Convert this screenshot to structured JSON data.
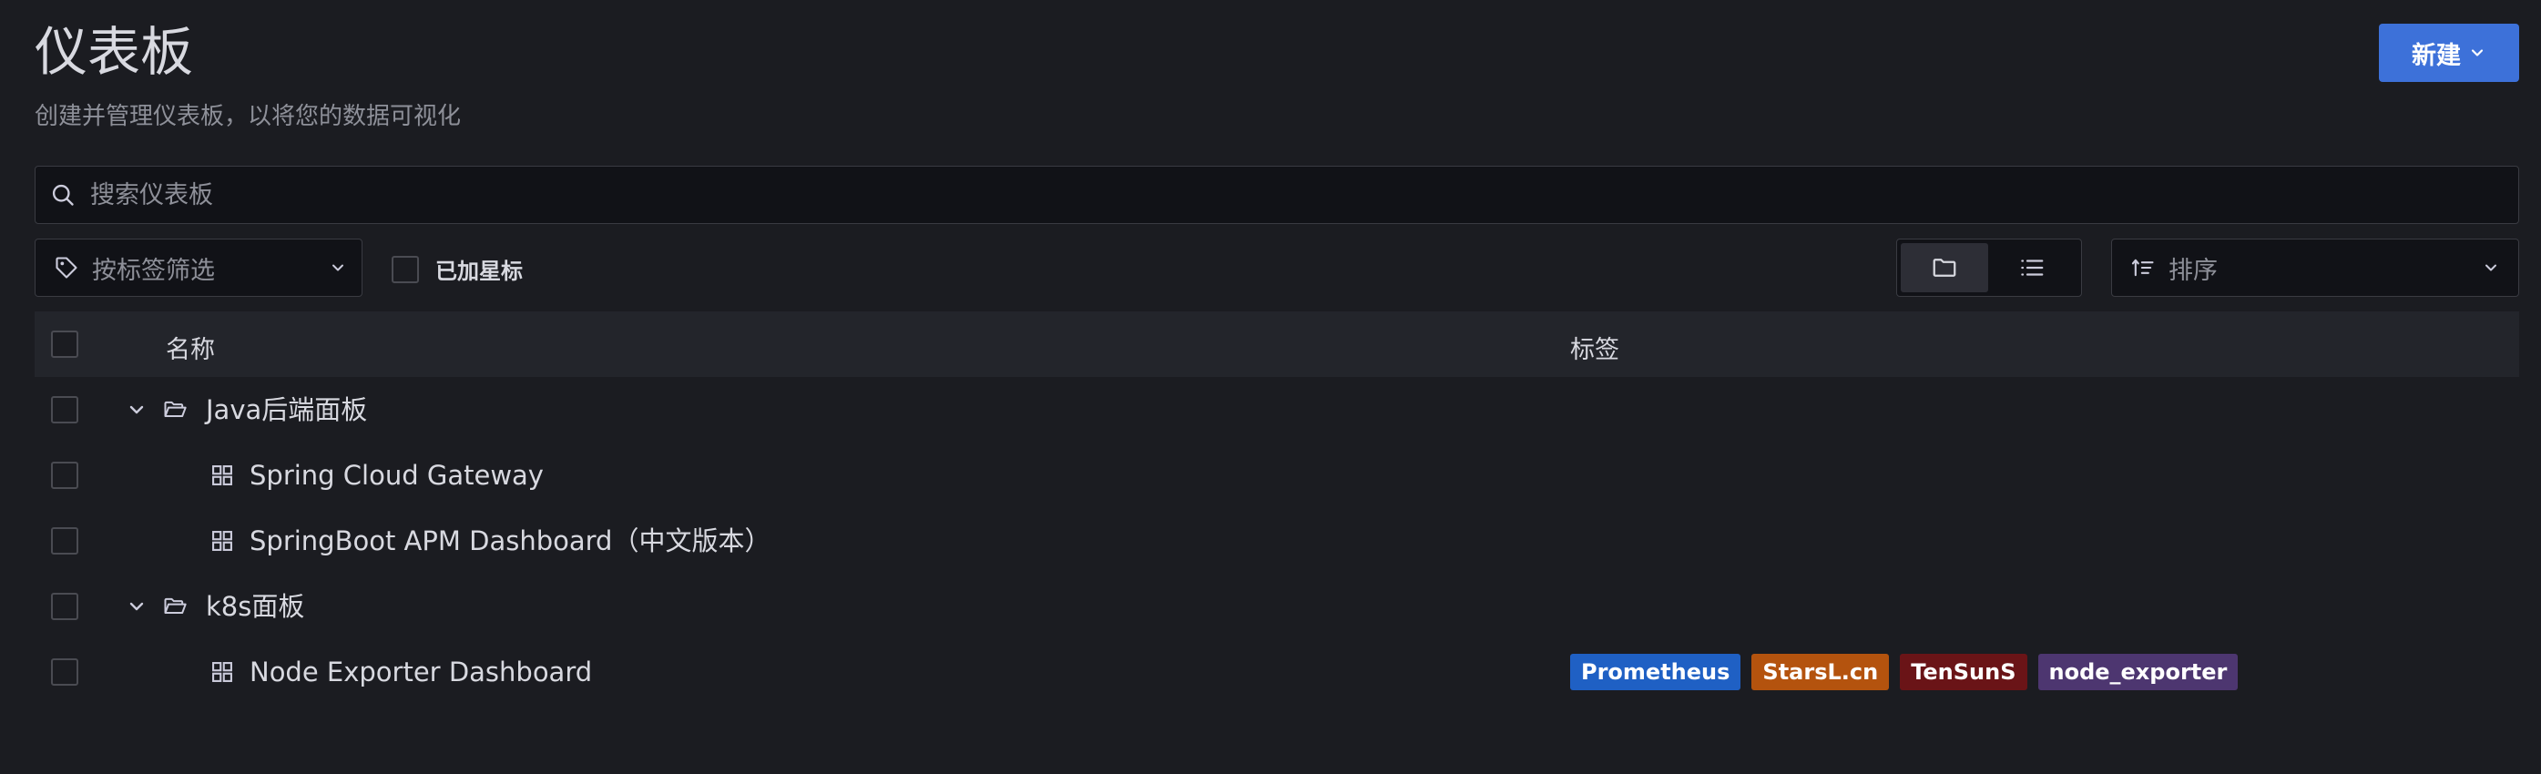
{
  "header": {
    "title": "仪表板",
    "subtitle": "创建并管理仪表板，以将您的数据可视化",
    "new_button_label": "新建"
  },
  "search": {
    "placeholder": "搜索仪表板"
  },
  "filters": {
    "tag_filter_placeholder": "按标签筛选",
    "starred_label": "已加星标",
    "view_mode": "folders",
    "sort_placeholder": "排序"
  },
  "table": {
    "columns": {
      "name": "名称",
      "tags": "标签"
    },
    "rows": [
      {
        "type": "folder",
        "name": "Java后端面板",
        "expanded": true
      },
      {
        "type": "dashboard",
        "name": "Spring Cloud Gateway",
        "tags": []
      },
      {
        "type": "dashboard",
        "name": "SpringBoot APM Dashboard（中文版本）",
        "tags": []
      },
      {
        "type": "folder",
        "name": "k8s面板",
        "expanded": true
      },
      {
        "type": "dashboard",
        "name": "Node Exporter Dashboard",
        "tags": [
          {
            "label": "Prometheus",
            "color": "#1f60c4"
          },
          {
            "label": "StarsL.cn",
            "color": "#b4530e"
          },
          {
            "label": "TenSunS",
            "color": "#6a1417"
          },
          {
            "label": "node_exporter",
            "color": "#4d3670"
          }
        ]
      }
    ]
  },
  "colors": {
    "primary": "#3d71d9",
    "background": "#1b1c21",
    "header_row": "#23252b"
  }
}
